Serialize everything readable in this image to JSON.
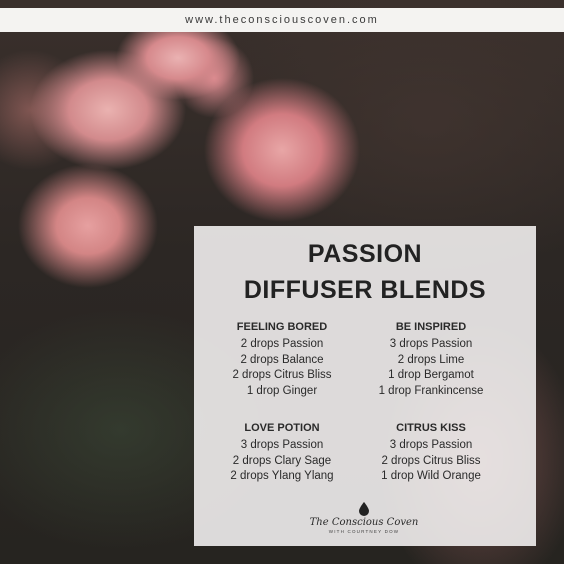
{
  "header": {
    "url": "www.theconsciouscoven.com"
  },
  "panel": {
    "title_line1": "PASSION",
    "title_line2": "DIFFUSER BLENDS",
    "blends": [
      {
        "name": "FEELING BORED",
        "lines": [
          "2 drops Passion",
          "2 drops Balance",
          "2 drops Citrus Bliss",
          "1 drop Ginger"
        ]
      },
      {
        "name": "BE INSPIRED",
        "lines": [
          "3 drops Passion",
          "2 drops Lime",
          "1 drop Bergamot",
          "1 drop Frankincense"
        ]
      },
      {
        "name": "LOVE POTION",
        "lines": [
          "3 drops Passion",
          "2 drops Clary Sage",
          "2 drops Ylang Ylang"
        ]
      },
      {
        "name": "CITRUS KISS",
        "lines": [
          "3 drops Passion",
          "2 drops Citrus Bliss",
          "1 drop Wild Orange"
        ]
      }
    ],
    "logo": {
      "brand": "The Conscious Coven",
      "tagline": "WITH COURTNEY DOW",
      "icon": "drop-icon"
    }
  },
  "colors": {
    "panel_bg": "#f6f4f4",
    "text": "#222222",
    "topbar_bg": "#f4f3f1"
  }
}
